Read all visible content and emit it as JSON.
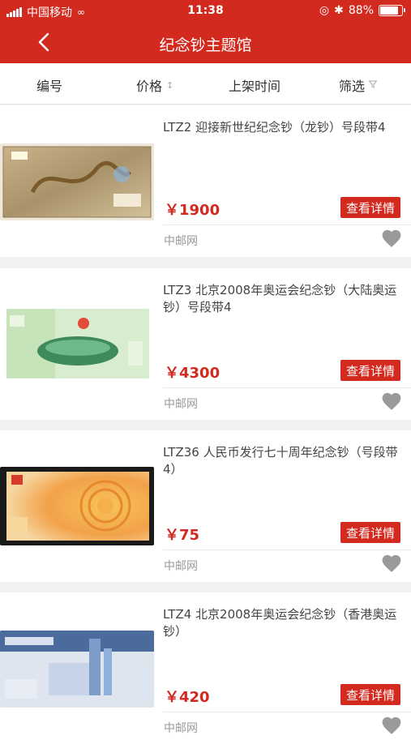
{
  "status_bar": {
    "carrier": "中国移动",
    "time": "11:38",
    "battery": "88%"
  },
  "nav": {
    "title": "纪念钞主题馆"
  },
  "filters": {
    "number": "编号",
    "price": "价格",
    "listed_time": "上架时间",
    "filter": "筛选"
  },
  "items": [
    {
      "title": "LTZ2 迎接新世纪纪念钞（龙钞）号段带4",
      "price": "￥1900",
      "detail": "查看详情",
      "source": "中邮网"
    },
    {
      "title": "LTZ3 北京2008年奥运会纪念钞（大陆奥运钞）号段带4",
      "price": "￥4300",
      "detail": "查看详情",
      "source": "中邮网"
    },
    {
      "title": "LTZ36 人民币发行七十周年纪念钞（号段带4）",
      "price": "￥75",
      "detail": "查看详情",
      "source": "中邮网"
    },
    {
      "title": "LTZ4 北京2008年奥运会纪念钞（香港奥运钞）",
      "price": "￥420",
      "detail": "查看详情",
      "source": "中邮网"
    }
  ]
}
